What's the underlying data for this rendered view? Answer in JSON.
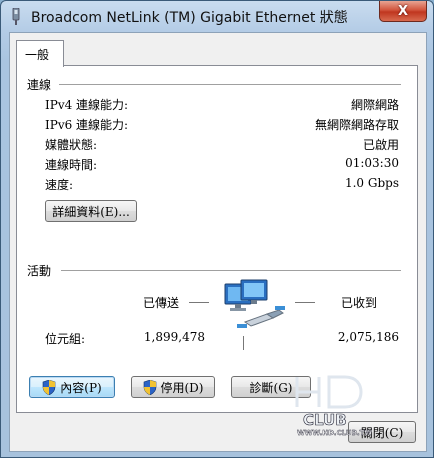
{
  "window": {
    "title": "Broadcom NetLink (TM) Gigabit Ethernet 狀態",
    "close_label": "X"
  },
  "tabs": [
    {
      "label": "一般"
    }
  ],
  "connection": {
    "heading": "連線",
    "rows": [
      {
        "label": "IPv4 連線能力:",
        "value": "網際網路"
      },
      {
        "label": "IPv6 連線能力:",
        "value": "無網際網路存取"
      },
      {
        "label": "媒體狀態:",
        "value": "已啟用"
      },
      {
        "label": "連線時間:",
        "value": "01:03:30"
      },
      {
        "label": "速度:",
        "value": "1.0 Gbps"
      }
    ],
    "details_button": "詳細資料(E)..."
  },
  "activity": {
    "heading": "活動",
    "sent_label": "已傳送",
    "received_label": "已收到",
    "bytes_label": "位元組:",
    "bytes_sent": "1,899,478",
    "bytes_received": "2,075,186"
  },
  "buttons": {
    "properties": "內容(P)",
    "disable": "停用(D)",
    "diagnose": "診斷(G)",
    "close": "關閉(C)"
  },
  "watermark": {
    "text": "HD CLUB",
    "url": "WWW.HD.CLUB.TW"
  },
  "colors": {
    "title_close": "#c0361f",
    "window_frame": "#a9c4e0",
    "panel_bg": "#ffffff",
    "dialog_bg": "#f0f0f0"
  },
  "icons": {
    "title": "network-adapter-icon",
    "activity": "network-computers-icon",
    "shield": "uac-shield-icon"
  }
}
